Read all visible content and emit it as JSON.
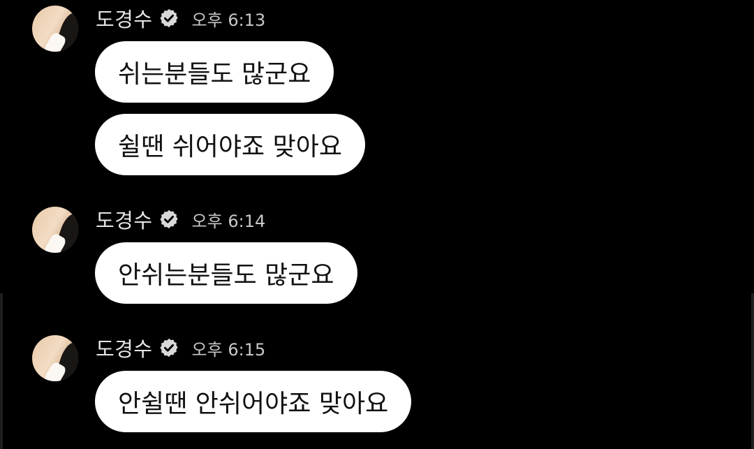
{
  "sender": {
    "name": "도경수",
    "verified_icon": "verified-badge-icon"
  },
  "messages": [
    {
      "time": "오후 6:13",
      "bubbles": [
        "쉬는분들도 많군요",
        "쉴땐 쉬어야죠 맞아요"
      ]
    },
    {
      "time": "오후 6:14",
      "bubbles": [
        "안쉬는분들도 많군요"
      ]
    },
    {
      "time": "오후 6:15",
      "bubbles": [
        "안쉴땐 안쉬어야죠 맞아요"
      ]
    }
  ],
  "colors": {
    "background": "#000000",
    "bubble": "#ffffff",
    "bubble_text": "#111111",
    "name_text": "#e6e6e6",
    "time_text": "#c8c8c8"
  }
}
